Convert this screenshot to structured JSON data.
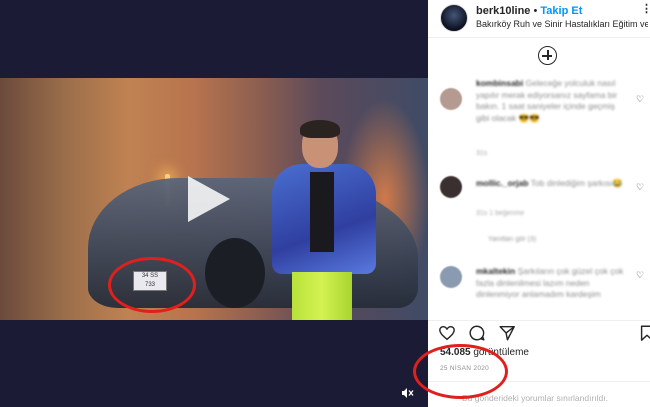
{
  "post": {
    "username": "berk10line",
    "separator": "•",
    "follow_label": "Takip Et",
    "location": "Bakırköy Ruh ve Sinir Hastalıkları Eğitim ve Ar...",
    "more_label": "⋮"
  },
  "video": {
    "plate_line1": "34  SS",
    "plate_line2": "733",
    "mute_icon": "speaker-muted-icon"
  },
  "comments": [
    {
      "user": "kombinsabi",
      "text": "Geleceğe yolculuk nasıl yapılır merak ediyorsanız sayfama bir bakın. 1 saat saniyeler içinde geçmiş gibi olacak 😎😎",
      "meta": "31s"
    },
    {
      "user": "mollic._orjab",
      "text": "Tob dinlediğim şarkısı😂",
      "meta": "31s   1 beğenme"
    },
    {
      "user": "mkaltekin",
      "text": "Şarkıların çok güzel çok çok fazla dinlenilmesi lazım neden dinlenmiyor anlamadım kardeşim",
      "meta": ""
    }
  ],
  "replies_label": "Yanıtları gör (3)",
  "stats": {
    "views_count": "54.085",
    "views_label": "görüntüleme",
    "date": "25 NİSAN 2020"
  },
  "footer": {
    "limited_label": "Bu gönderideki yorumlar sınırlandırıldı."
  },
  "colors": {
    "accent": "#0095f6",
    "annotation": "#e0201c"
  }
}
